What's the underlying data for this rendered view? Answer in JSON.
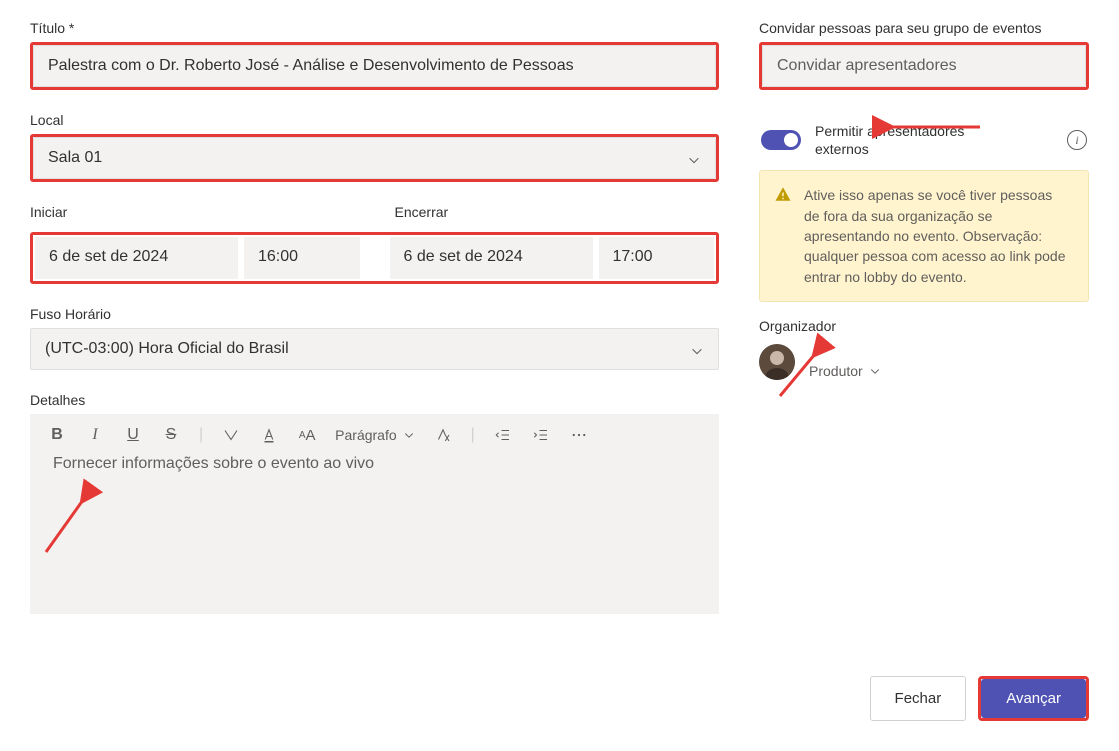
{
  "labels": {
    "title": "Título *",
    "location": "Local",
    "start": "Iniciar",
    "end": "Encerrar",
    "timezone": "Fuso Horário",
    "details": "Detalhes",
    "invite_header": "Convidar pessoas para seu grupo de eventos",
    "organizer": "Organizador"
  },
  "fields": {
    "title_value": "Palestra com o Dr. Roberto José - Análise e Desenvolvimento de Pessoas",
    "location_value": "Sala 01",
    "start_date": "6 de set de 2024",
    "start_time": "16:00",
    "end_date": "6 de set de 2024",
    "end_time": "17:00",
    "timezone_value": "(UTC-03:00) Hora Oficial do Brasil",
    "invite_placeholder": "Convidar apresentadores"
  },
  "editor": {
    "paragraph_label": "Parágrafo",
    "placeholder": "Fornecer informações sobre o evento ao vivo"
  },
  "toggle": {
    "label": "Permitir apresentadores externos",
    "on": true
  },
  "warning_text": "Ative isso apenas se você tiver pessoas de fora da sua organização se apresentando no evento. Observação: qualquer pessoa com acesso ao link pode entrar no lobby do evento.",
  "organizer": {
    "name": "",
    "role": "Produtor"
  },
  "buttons": {
    "close": "Fechar",
    "next": "Avançar"
  },
  "colors": {
    "highlight": "#e53935",
    "primary": "#4f52b2",
    "warning_bg": "#fff4ce"
  }
}
